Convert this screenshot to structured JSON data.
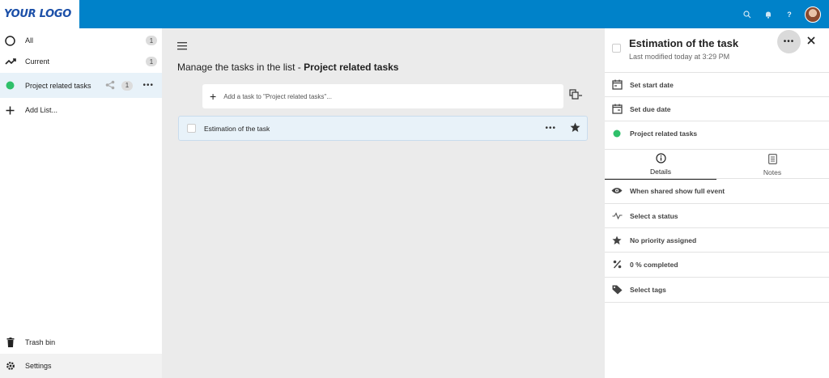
{
  "header": {
    "logo_text": "YOUR LOGO",
    "brand_color": "#0082c9",
    "icons": [
      "search-icon",
      "bell-icon",
      "help-icon",
      "avatar"
    ]
  },
  "sidebar": {
    "items": [
      {
        "label": "All",
        "count": "1",
        "icon": "circle-icon"
      },
      {
        "label": "Current",
        "count": "1",
        "icon": "trending-icon"
      },
      {
        "label": "Project related tasks",
        "count": "1",
        "icon": "green-dot-icon",
        "color": "#2fc06a"
      },
      {
        "label": "Add List...",
        "icon": "plus-icon"
      }
    ],
    "trash_label": "Trash bin",
    "settings_label": "Settings"
  },
  "main": {
    "title_prefix": "Manage the tasks in the list - ",
    "title_list": "Project related tasks",
    "add_placeholder": "Add a task to \"Project related tasks\"...",
    "tasks": [
      {
        "name": "Estimation of the task"
      }
    ]
  },
  "panel": {
    "title": "Estimation of the task",
    "subtitle": "Last modified today at 3:29 PM",
    "start_date_label": "Set start date",
    "due_date_label": "Set due date",
    "list_label": "Project related tasks",
    "tabs": [
      {
        "label": "Details",
        "icon": "info-icon"
      },
      {
        "label": "Notes",
        "icon": "notes-icon"
      }
    ],
    "rows": [
      {
        "label": "When shared show full event",
        "icon": "eye-icon"
      },
      {
        "label": "Select a status",
        "icon": "pulse-icon"
      },
      {
        "label": "No priority assigned",
        "icon": "star-icon"
      },
      {
        "label": "0 % completed",
        "icon": "percent-icon"
      },
      {
        "label": "Select tags",
        "icon": "tag-icon"
      }
    ]
  }
}
